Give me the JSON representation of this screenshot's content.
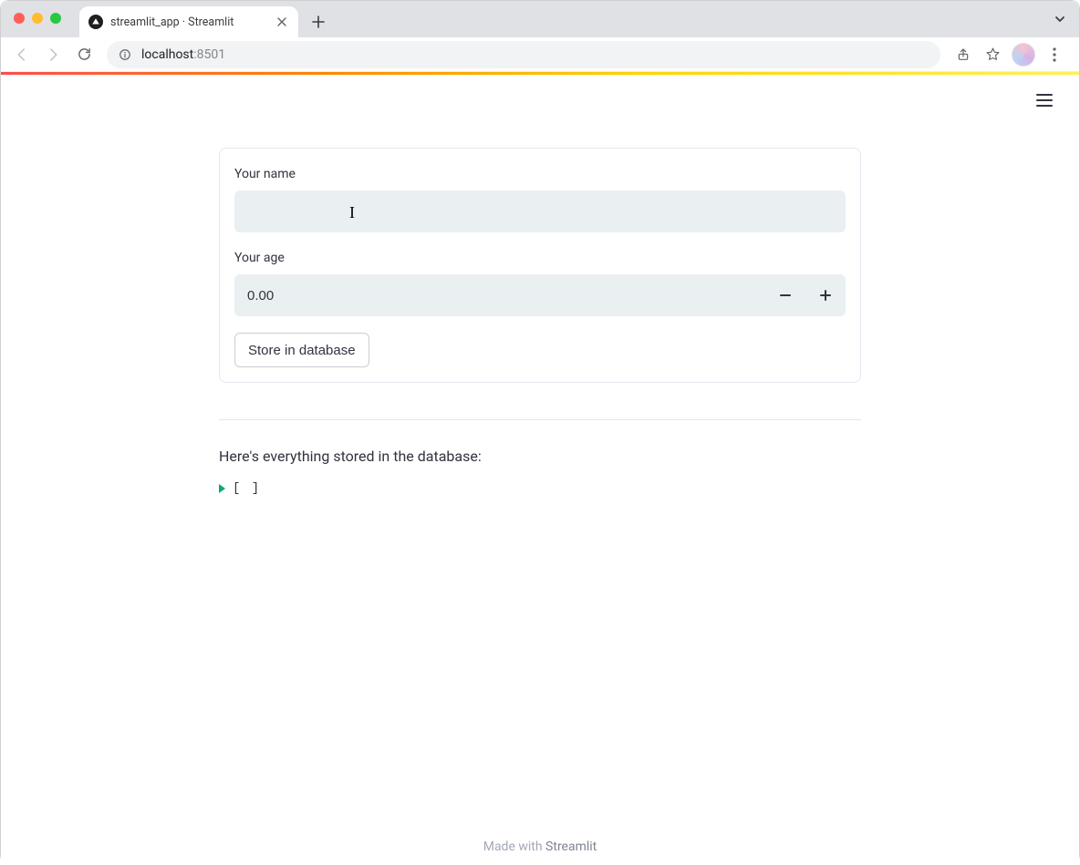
{
  "browser": {
    "tab_title": "streamlit_app · Streamlit",
    "url_host": "localhost",
    "url_port": ":8501"
  },
  "form": {
    "name_label": "Your name",
    "name_value": "",
    "age_label": "Your age",
    "age_value": "0.00",
    "submit_label": "Store in database"
  },
  "db": {
    "heading_text": "Here's everything stored in the database:",
    "json_value": "[ ]"
  },
  "footer": {
    "prefix": "Made with ",
    "brand": "Streamlit"
  }
}
